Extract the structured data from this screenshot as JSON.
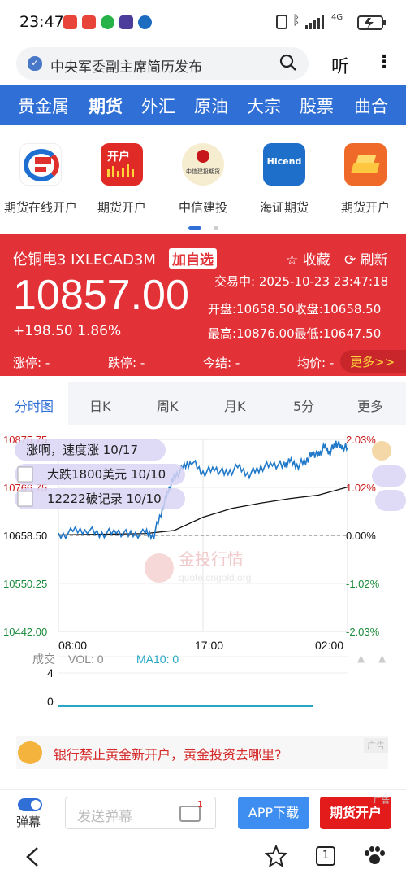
{
  "status_bar": {
    "time": "23:47",
    "network": "4G",
    "battery_icon": "battery-icon"
  },
  "browser": {
    "query": "中央军委副主席简历发布",
    "listen": "听"
  },
  "nav": {
    "items": [
      "贵金属",
      "期货",
      "外汇",
      "原油",
      "大宗",
      "股票",
      "曲合"
    ]
  },
  "apps": [
    {
      "label": "期货在线开户",
      "icon": "futures-online-icon"
    },
    {
      "label": "期货开户",
      "icon": "open-account-icon",
      "badge": "开户"
    },
    {
      "label": "中信建投",
      "icon": "citic-futures-logo",
      "logo_text": "中信建投期货"
    },
    {
      "label": "海证期货",
      "icon": "hicend-logo",
      "logo_text": "Hicend"
    },
    {
      "label": "期货开户",
      "icon": "gold-bars-icon"
    }
  ],
  "quote": {
    "name": "伦铜电3 IXLECAD3M",
    "add_watch": "加自选",
    "favorite": "收藏",
    "refresh": "刷新",
    "price": "10857.00",
    "change": "+198.50 1.86%",
    "trading_time": "交易中: 2025-10-23 23:47:18",
    "open": "开盘:10658.50",
    "close": "收盘:10658.50",
    "high": "最高:10876.00",
    "low": "最低:10647.50",
    "limit_up": "涨停: -",
    "limit_down": "跌停: -",
    "settle": "今结: -",
    "avg": "均价: -",
    "more": "更多>>"
  },
  "tabs": [
    "分时图",
    "日K",
    "周K",
    "月K",
    "5分",
    "更多"
  ],
  "chart_data": {
    "type": "line",
    "x_ticks": [
      "08:00",
      "17:00",
      "02:00"
    ],
    "y_ticks_left": [
      "10875.75",
      "10766.75",
      "10658.50",
      "10550.25",
      "10442.00"
    ],
    "y_ticks_right": [
      "2.03%",
      "1.02%",
      "0.00%",
      "-1.02%",
      "-2.03%"
    ],
    "ylim": [
      10442.0,
      10875.75
    ],
    "base": 10658.5,
    "price": {
      "x": [
        0,
        5,
        10,
        15,
        20,
        25,
        30,
        33,
        36,
        38,
        40,
        43,
        46,
        50,
        54,
        58,
        62,
        66,
        70,
        74,
        78,
        80,
        83,
        86,
        88,
        90,
        92,
        94,
        96,
        98,
        100
      ],
      "y": [
        10655,
        10668,
        10672,
        10662,
        10668,
        10660,
        10664,
        10660,
        10720,
        10760,
        10790,
        10810,
        10828,
        10800,
        10810,
        10798,
        10812,
        10798,
        10812,
        10820,
        10816,
        10825,
        10818,
        10830,
        10845,
        10840,
        10858,
        10848,
        10868,
        10858,
        10857
      ]
    },
    "avg": {
      "x": [
        0,
        20,
        30,
        40,
        50,
        60,
        70,
        80,
        90,
        100
      ],
      "y": [
        10660,
        10662,
        10663,
        10670,
        10700,
        10720,
        10732,
        10742,
        10750,
        10768
      ]
    },
    "news": [
      "涨啊，速度涨 10/17",
      "大跌1800美元 10/10",
      "12222破记录 10/10"
    ],
    "watermark": "金投行情",
    "watermark_url": "quote.cngold.org",
    "vol_label": "成交",
    "vol_text": "VOL: 0",
    "ma10_text": "MA10: 0",
    "vol_ticks": [
      "4",
      "0"
    ]
  },
  "ad": {
    "text": "银行禁止黄金新开户，黄金投资去哪里?",
    "badge": "广告"
  },
  "bottom": {
    "danmu": "弹幕",
    "placeholder": "发送弹幕",
    "msg_count": "1",
    "app_download": "APP下载",
    "futures_open": "期货开户",
    "ad_tag": "广告"
  },
  "sysnav": {
    "tab_count": "1"
  },
  "colors": {
    "accent": "#2f6fd6",
    "red": "#e23238",
    "up": "#c81c1c",
    "down": "#1a8a3a",
    "line": "#1f78c8"
  }
}
